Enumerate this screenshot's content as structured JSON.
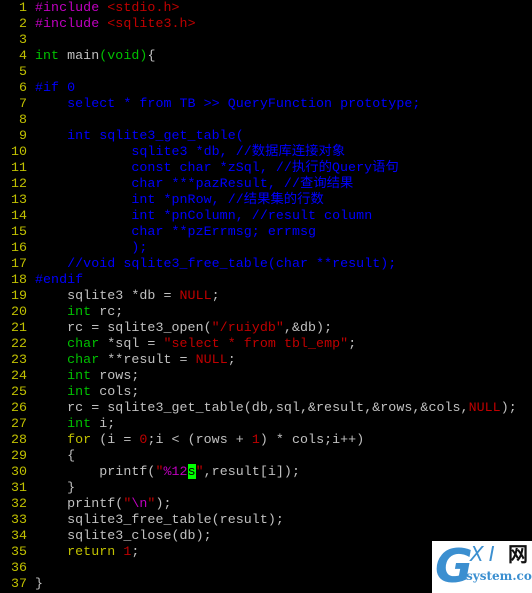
{
  "editor": {
    "cursor": {
      "line": 30,
      "char": "s"
    },
    "colors": {
      "line_number": "#c0c000",
      "default_text": "#c0c0c0",
      "preprocessor": "#c000c0",
      "string": "#c00000",
      "type": "#00c000",
      "keyword": "#c0c000",
      "comment": "#0000ff",
      "cursor_bg": "#00ff00"
    },
    "lines": [
      {
        "n": "1",
        "tokens": [
          [
            "pre",
            "#include"
          ],
          [
            "def",
            " "
          ],
          [
            "str",
            "<stdio.h>"
          ]
        ]
      },
      {
        "n": "2",
        "tokens": [
          [
            "pre",
            "#include"
          ],
          [
            "def",
            " "
          ],
          [
            "str",
            "<sqlite3.h>"
          ]
        ]
      },
      {
        "n": "3",
        "tokens": []
      },
      {
        "n": "4",
        "tokens": [
          [
            "type",
            "int"
          ],
          [
            "def",
            " main"
          ],
          [
            "type",
            "("
          ],
          [
            "type",
            "void"
          ],
          [
            "type",
            ")"
          ],
          [
            "def",
            "{"
          ]
        ]
      },
      {
        "n": "5",
        "tokens": []
      },
      {
        "n": "6",
        "tokens": [
          [
            "cmt",
            "#if 0"
          ]
        ]
      },
      {
        "n": "7",
        "tokens": [
          [
            "cmt",
            "    select * from TB >> QueryFunction prototype;"
          ]
        ]
      },
      {
        "n": "8",
        "tokens": []
      },
      {
        "n": "9",
        "tokens": [
          [
            "cmt",
            "    int sqlite3_get_table("
          ]
        ]
      },
      {
        "n": "10",
        "tokens": [
          [
            "cmt",
            "            sqlite3 *db, //数据库连接对象"
          ]
        ]
      },
      {
        "n": "11",
        "tokens": [
          [
            "cmt",
            "            const char *zSql, //执行的Query语句"
          ]
        ]
      },
      {
        "n": "12",
        "tokens": [
          [
            "cmt",
            "            char ***pazResult, //查询结果"
          ]
        ]
      },
      {
        "n": "13",
        "tokens": [
          [
            "cmt",
            "            int *pnRow, //结果集的行数"
          ]
        ]
      },
      {
        "n": "14",
        "tokens": [
          [
            "cmt",
            "            int *pnColumn, //result column"
          ]
        ]
      },
      {
        "n": "15",
        "tokens": [
          [
            "cmt",
            "            char **pzErrmsg; errmsg"
          ]
        ]
      },
      {
        "n": "16",
        "tokens": [
          [
            "cmt",
            "            );"
          ]
        ]
      },
      {
        "n": "17",
        "tokens": [
          [
            "cmt",
            "    //void sqlite3_free_table(char **result);"
          ]
        ]
      },
      {
        "n": "18",
        "tokens": [
          [
            "cmt",
            "#endif"
          ]
        ]
      },
      {
        "n": "19",
        "tokens": [
          [
            "def",
            "    sqlite3 *db = "
          ],
          [
            "null",
            "NULL"
          ],
          [
            "def",
            ";"
          ]
        ]
      },
      {
        "n": "20",
        "tokens": [
          [
            "def",
            "    "
          ],
          [
            "type",
            "int"
          ],
          [
            "def",
            " rc;"
          ]
        ]
      },
      {
        "n": "21",
        "tokens": [
          [
            "def",
            "    rc = sqlite3_open("
          ],
          [
            "str",
            "\"/ruiydb\""
          ],
          [
            "def",
            ",&db);"
          ]
        ]
      },
      {
        "n": "22",
        "tokens": [
          [
            "def",
            "    "
          ],
          [
            "type",
            "char"
          ],
          [
            "def",
            " *sql = "
          ],
          [
            "str",
            "\"select * from tbl_emp\""
          ],
          [
            "def",
            ";"
          ]
        ]
      },
      {
        "n": "23",
        "tokens": [
          [
            "def",
            "    "
          ],
          [
            "type",
            "char"
          ],
          [
            "def",
            " **result = "
          ],
          [
            "null",
            "NULL"
          ],
          [
            "def",
            ";"
          ]
        ]
      },
      {
        "n": "24",
        "tokens": [
          [
            "def",
            "    "
          ],
          [
            "type",
            "int"
          ],
          [
            "def",
            " rows;"
          ]
        ]
      },
      {
        "n": "25",
        "tokens": [
          [
            "def",
            "    "
          ],
          [
            "type",
            "int"
          ],
          [
            "def",
            " cols;"
          ]
        ]
      },
      {
        "n": "26",
        "tokens": [
          [
            "def",
            "    rc = sqlite3_get_table(db,sql,&result,&rows,&cols,"
          ],
          [
            "null",
            "NULL"
          ],
          [
            "def",
            ");"
          ]
        ]
      },
      {
        "n": "27",
        "tokens": [
          [
            "def",
            "    "
          ],
          [
            "type",
            "int"
          ],
          [
            "def",
            " i;"
          ]
        ]
      },
      {
        "n": "28",
        "tokens": [
          [
            "def",
            "    "
          ],
          [
            "kw2",
            "for"
          ],
          [
            "def",
            " (i = "
          ],
          [
            "num",
            "0"
          ],
          [
            "def",
            ";i < (rows + "
          ],
          [
            "num",
            "1"
          ],
          [
            "def",
            ") * cols;i++)"
          ]
        ]
      },
      {
        "n": "29",
        "tokens": [
          [
            "def",
            "    {"
          ]
        ]
      },
      {
        "n": "30",
        "tokens": [
          [
            "def",
            "        printf("
          ],
          [
            "str",
            "\""
          ],
          [
            "spec",
            "%12"
          ],
          [
            "cursor",
            "s"
          ],
          [
            "str",
            "\""
          ],
          [
            "def",
            ",result[i]);"
          ]
        ]
      },
      {
        "n": "31",
        "tokens": [
          [
            "def",
            "    }"
          ]
        ]
      },
      {
        "n": "32",
        "tokens": [
          [
            "def",
            "    printf("
          ],
          [
            "str",
            "\""
          ],
          [
            "spec",
            "\\n"
          ],
          [
            "str",
            "\""
          ],
          [
            "def",
            ");"
          ]
        ]
      },
      {
        "n": "33",
        "tokens": [
          [
            "def",
            "    sqlite3_free_table(result);"
          ]
        ]
      },
      {
        "n": "34",
        "tokens": [
          [
            "def",
            "    sqlite3_close(db);"
          ]
        ]
      },
      {
        "n": "35",
        "tokens": [
          [
            "def",
            "    "
          ],
          [
            "kw",
            "return"
          ],
          [
            "def",
            " "
          ],
          [
            "num",
            "1"
          ],
          [
            "def",
            ";"
          ]
        ]
      },
      {
        "n": "36",
        "tokens": []
      },
      {
        "n": "37",
        "tokens": [
          [
            "def",
            "}"
          ]
        ]
      }
    ]
  },
  "watermark": {
    "logo_letter": "G",
    "logo_text": "XI",
    "logo_cjk": "网",
    "site": "system.com"
  }
}
